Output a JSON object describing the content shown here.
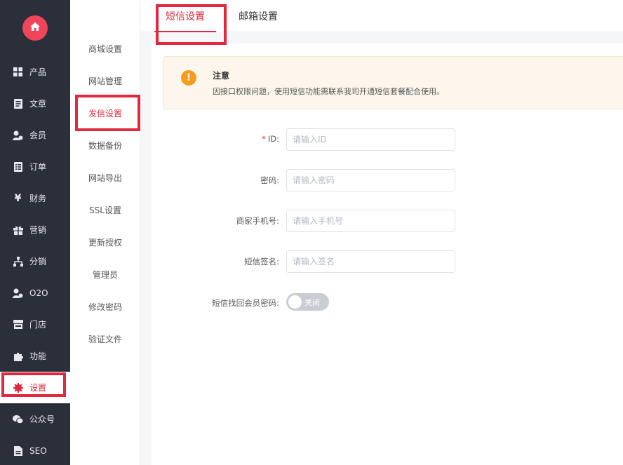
{
  "colors": {
    "accent": "#e0283f",
    "sidebar_bg": "#2b2f3a",
    "warning": "#f89c1c"
  },
  "sidebar": {
    "logo_icon": "home-icon",
    "items": [
      {
        "label": "产品",
        "icon": "grid-icon"
      },
      {
        "label": "文章",
        "icon": "document-icon"
      },
      {
        "label": "会员",
        "icon": "member-icon"
      },
      {
        "label": "订单",
        "icon": "list-icon"
      },
      {
        "label": "财务",
        "icon": "yen-icon"
      },
      {
        "label": "营销",
        "icon": "gift-icon"
      },
      {
        "label": "分销",
        "icon": "hierarchy-icon"
      },
      {
        "label": "O2O",
        "icon": "member-icon"
      },
      {
        "label": "门店",
        "icon": "store-icon"
      },
      {
        "label": "功能",
        "icon": "puzzle-icon"
      },
      {
        "label": "设置",
        "icon": "gear-icon",
        "active": true
      },
      {
        "label": "公众号",
        "icon": "wechat-icon"
      },
      {
        "label": "SEO",
        "icon": "file-icon"
      }
    ]
  },
  "subnav": {
    "items": [
      {
        "label": "商城设置"
      },
      {
        "label": "网站管理"
      },
      {
        "label": "发信设置",
        "active": true
      },
      {
        "label": "数据备份"
      },
      {
        "label": "网站导出"
      },
      {
        "label": "SSL设置"
      },
      {
        "label": "更新授权"
      },
      {
        "label": "管理员"
      },
      {
        "label": "修改密码"
      },
      {
        "label": "验证文件"
      }
    ]
  },
  "tabs": [
    {
      "label": "短信设置",
      "active": true
    },
    {
      "label": "邮箱设置"
    }
  ],
  "notice": {
    "title": "注意",
    "text": "因接口权限问题，使用短信功能需联系我司开通短信套餐配合使用。"
  },
  "form": {
    "id": {
      "label": "ID:",
      "placeholder": "请输入ID",
      "required": true
    },
    "password": {
      "label": "密码:",
      "placeholder": "请输入密码"
    },
    "phone": {
      "label": "商家手机号:",
      "placeholder": "请输入手机号"
    },
    "signature": {
      "label": "短信签名:",
      "placeholder": "请输入签名"
    },
    "recover": {
      "label": "短信找回会员密码:",
      "toggle_text": "关闭",
      "on": false
    }
  }
}
